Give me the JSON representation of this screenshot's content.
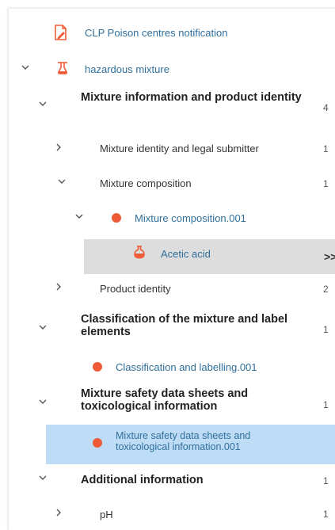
{
  "tree": {
    "notification": {
      "label": "CLP Poison centres notification",
      "icon": "edit-document-icon"
    },
    "mixture": {
      "label": "hazardous mixture",
      "icon": "flask-icon"
    },
    "section1": {
      "title": "Mixture information and product identity",
      "count": "4",
      "identity": {
        "label": "Mixture identity and legal submitter",
        "count": "1"
      },
      "composition": {
        "label": "Mixture composition",
        "count": "1",
        "doc": {
          "label": "Mixture composition.001"
        },
        "substance": {
          "label": "Acetic acid",
          "icon": "flask-icon",
          "action": ">>"
        }
      },
      "product": {
        "label": "Product identity",
        "count": "2"
      }
    },
    "section2": {
      "title": "Classification of the mixture and label elements",
      "count": "1",
      "doc": {
        "label": "Classification and labelling.001"
      }
    },
    "section3": {
      "title": "Mixture safety data sheets and toxicological information",
      "count": "1",
      "doc": {
        "label": "Mixture safety data sheets and toxicological information.001"
      }
    },
    "section4": {
      "title": "Additional information",
      "count": "1",
      "ph": {
        "label": "pH",
        "count": "1"
      }
    }
  },
  "colors": {
    "status_dot": "#ef5b36",
    "link": "#2f6f9a",
    "selected_bg": "#bfdcf7",
    "hover_bg": "#dddddd"
  }
}
